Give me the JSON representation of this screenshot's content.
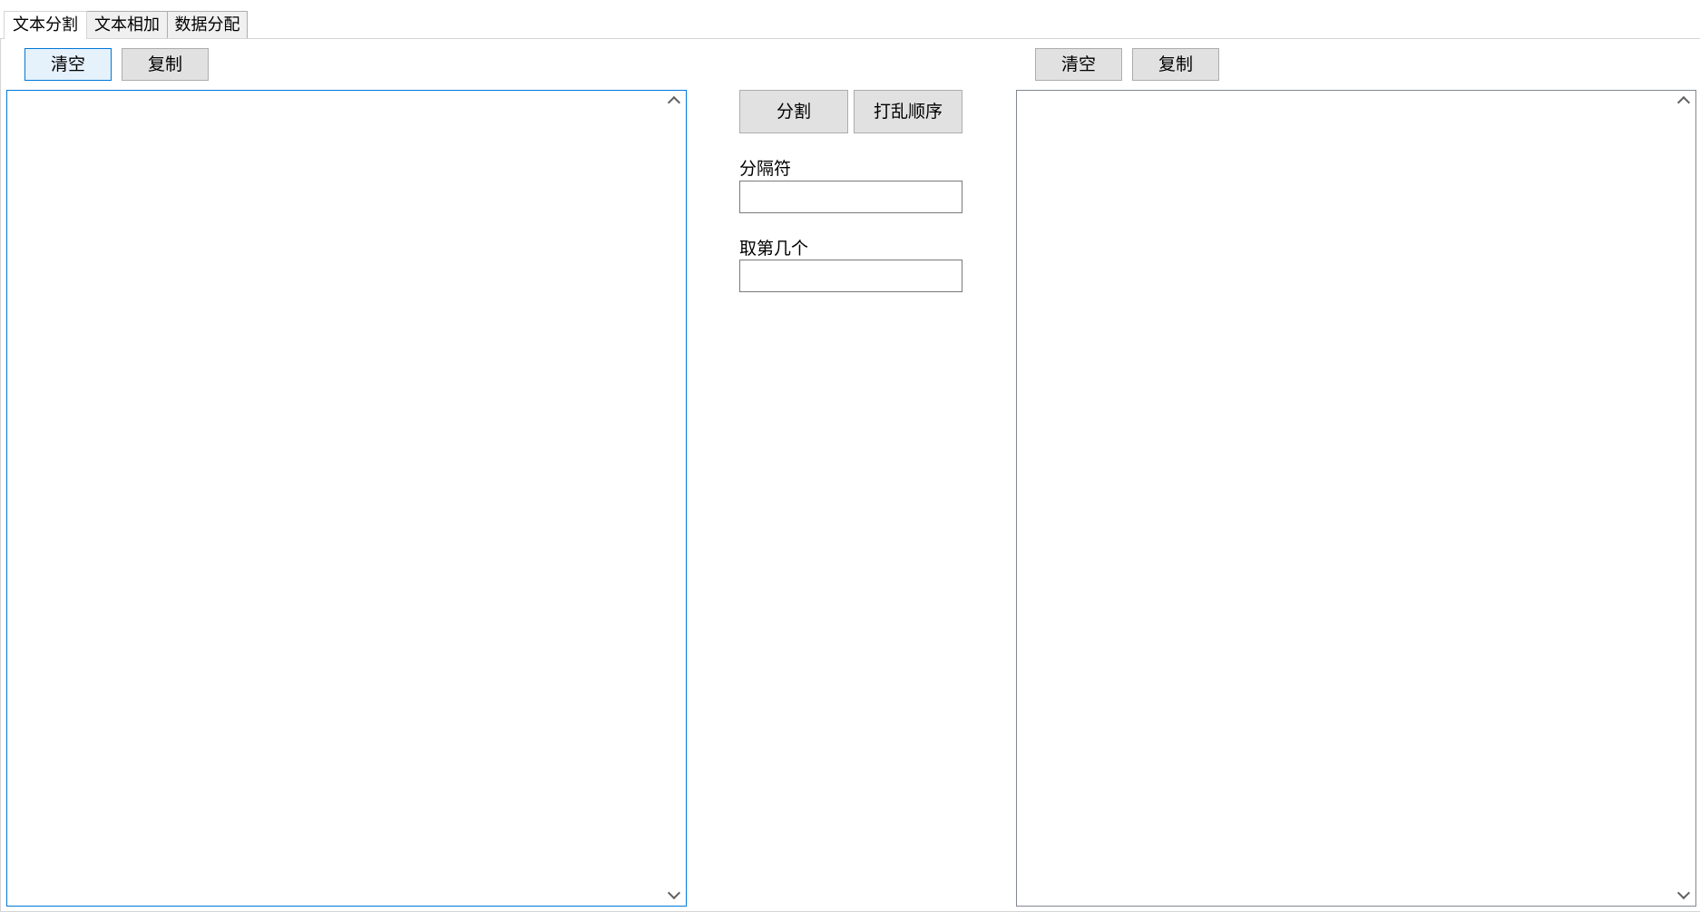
{
  "tabs": [
    {
      "label": "文本分割",
      "active": true
    },
    {
      "label": "文本相加",
      "active": false
    },
    {
      "label": "数据分配",
      "active": false
    }
  ],
  "left_panel": {
    "clear_label": "清空",
    "copy_label": "复制",
    "text_value": ""
  },
  "middle_panel": {
    "split_label": "分割",
    "shuffle_label": "打乱顺序",
    "separator_label": "分隔符",
    "separator_value": "",
    "nth_label": "取第几个",
    "nth_value": ""
  },
  "right_panel": {
    "clear_label": "清空",
    "copy_label": "复制",
    "text_value": ""
  },
  "icons": {
    "scroll_up": "chevron-up-icon",
    "scroll_down": "chevron-down-icon"
  },
  "colors": {
    "focus_border": "#0078d7",
    "button_face": "#e1e1e1",
    "focused_button_face": "#e5f1fb"
  }
}
